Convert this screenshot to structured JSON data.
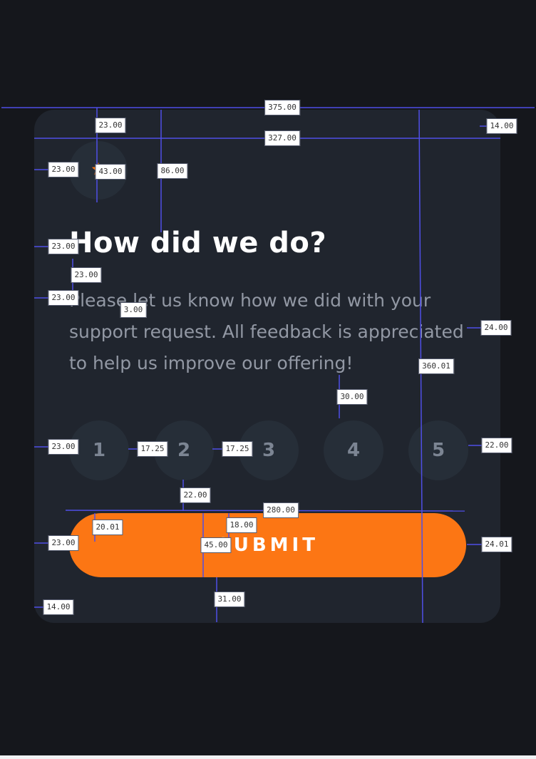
{
  "colors": {
    "page_background": "#15171c",
    "card_background": "#20252e",
    "rating_circle": "#262e38",
    "accent_orange": "#fc7614",
    "measure_line": "#4f4fe6"
  },
  "card": {
    "icon": "star-icon",
    "title": "How did we do?",
    "description": "Please let us know how we did with your support request. All feedback is appreciated to help us improve our offering!",
    "ratings": [
      "1",
      "2",
      "3",
      "4",
      "5"
    ],
    "submit_label": "SUBMIT"
  },
  "measurements": [
    "375.00",
    "327.00",
    "14.00",
    "23.00",
    "86.00",
    "23.00",
    "43.00",
    "23.00",
    "23.00",
    "23.00",
    "3.00",
    "24.00",
    "360.01",
    "30.00",
    "23.00",
    "17.25",
    "17.25",
    "22.00",
    "22.00",
    "280.00",
    "20.01",
    "18.00",
    "45.00",
    "23.00",
    "24.01",
    "31.00",
    "14.00"
  ]
}
